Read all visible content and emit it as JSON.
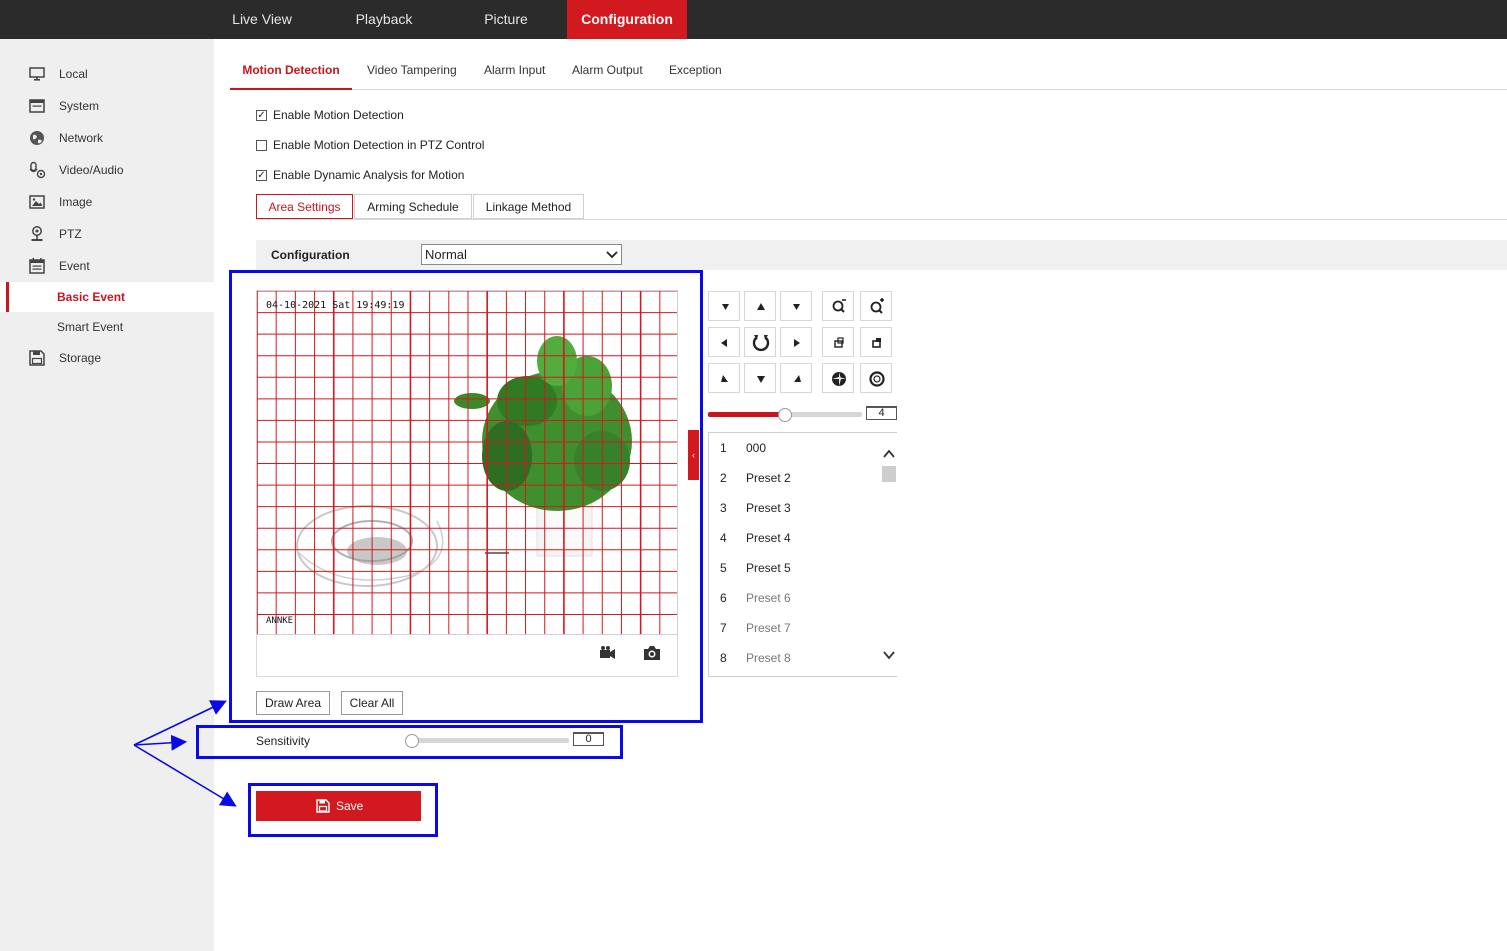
{
  "topnav": [
    "Live View",
    "Playback",
    "Picture",
    "Configuration"
  ],
  "sidebar": {
    "items": [
      "Local",
      "System",
      "Network",
      "Video/Audio",
      "Image",
      "PTZ",
      "Event"
    ],
    "event_children": [
      "Basic Event",
      "Smart Event"
    ],
    "storage": "Storage"
  },
  "tabs": [
    "Motion Detection",
    "Video Tampering",
    "Alarm Input",
    "Alarm Output",
    "Exception"
  ],
  "checkboxes": [
    {
      "label": "Enable Motion Detection",
      "checked": true
    },
    {
      "label": "Enable Motion Detection in PTZ Control",
      "checked": false
    },
    {
      "label": "Enable Dynamic Analysis for Motion",
      "checked": true
    }
  ],
  "subtabs": [
    "Area Settings",
    "Arming Schedule",
    "Linkage Method"
  ],
  "configuration": {
    "label": "Configuration",
    "value": "Normal"
  },
  "video": {
    "timestamp": "04-10-2021 Sat 19:49:19",
    "brand": "ANNKE"
  },
  "buttons": {
    "draw_area": "Draw Area",
    "clear_all": "Clear All",
    "save": "Save"
  },
  "sensitivity": {
    "label": "Sensitivity",
    "value": "0",
    "level": 0
  },
  "ptz_speed": {
    "value": "4",
    "level": 0.5
  },
  "presets": [
    {
      "num": "1",
      "name": "000"
    },
    {
      "num": "2",
      "name": "Preset 2"
    },
    {
      "num": "3",
      "name": "Preset 3"
    },
    {
      "num": "4",
      "name": "Preset 4"
    },
    {
      "num": "5",
      "name": "Preset 5"
    },
    {
      "num": "6",
      "name": "Preset 6"
    },
    {
      "num": "7",
      "name": "Preset 7"
    },
    {
      "num": "8",
      "name": "Preset 8"
    }
  ],
  "colors": {
    "accent": "#d2191f",
    "highlight": "#0a0ae6",
    "topbar": "#2b2b2b"
  }
}
